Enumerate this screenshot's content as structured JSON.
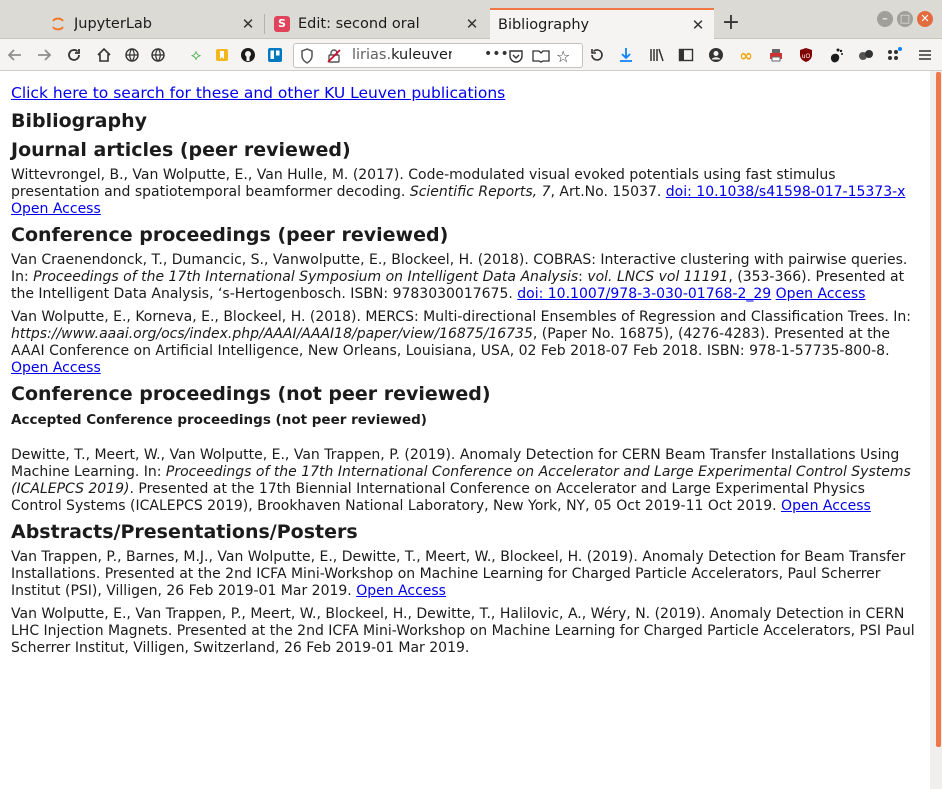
{
  "browser": {
    "tabs": [
      {
        "title": "JupyterLab",
        "favicon_color": "#f37626"
      },
      {
        "title": "Edit: second oral",
        "favicon_color": "#e0445c"
      },
      {
        "title": "Bibliography",
        "favicon_color": ""
      }
    ],
    "url_prefix": "lirias.",
    "url_domain": "kuleuven.",
    "url_more": "•••"
  },
  "page": {
    "search_link": "Click here to search for these and other KU Leuven publications",
    "title": "Bibliography",
    "sections": {
      "journal": {
        "heading": "Journal articles (peer reviewed)",
        "entries": [
          {
            "text_a": "Wittevrongel, B., Van Wolputte, E., Van Hulle, M. (2017). Code-modulated visual evoked potentials using fast stimulus presentation and spatiotemporal beamformer decoding. ",
            "italic_a": "Scientific Reports, 7",
            "text_b": ", Art.No. 15037. ",
            "doi": "doi: 10.1038/s41598-017-15373-x",
            "open_access": "Open Access"
          }
        ]
      },
      "conf_peer": {
        "heading": "Conference proceedings (peer reviewed)",
        "entries": [
          {
            "text_a": "Van Craenendonck, T., Dumancic, S., Vanwolputte, E., Blockeel, H. (2018). COBRAS: Interactive clustering with pairwise queries. In: ",
            "italic_a": "Proceedings of the 17th International Symposium on Intelligent Data Analysis",
            "text_b": ": ",
            "italic_b": "vol. LNCS vol 11191",
            "text_c": ", (353-366). Presented at the Intelligent Data Analysis, ‘s-Hertogenbosch. ISBN: 9783030017675. ",
            "doi": "doi: 10.1007/978-3-030-01768-2_29",
            "open_access": "Open Access"
          },
          {
            "text_a": "Van Wolputte, E., Korneva, E., Blockeel, H. (2018). MERCS: Multi-directional Ensembles of Regression and Classification Trees. In: ",
            "italic_a": "https://www.aaai.org/ocs/index.php/AAAI/AAAI18/paper/view/16875/16735",
            "text_b": ", (Paper No. 16875), (4276-4283). Presented at the AAAI Conference on Artificial Intelligence, New Orleans, Louisiana, USA, 02 Feb 2018-07 Feb 2018. ISBN: 978-1-57735-800-8. ",
            "open_access": "Open Access"
          }
        ]
      },
      "conf_not_peer": {
        "heading": "Conference proceedings (not peer reviewed)",
        "subheading": "Accepted Conference proceedings (not peer reviewed)",
        "entries": [
          {
            "text_a": "Dewitte, T., Meert, W., Van Wolputte, E., Van Trappen, P. (2019). Anomaly Detection for CERN Beam Transfer Installations Using Machine Learning. In: ",
            "italic_a": "Proceedings of the 17th International Conference on Accelerator and Large Experimental Control Systems (ICALEPCS 2019)",
            "text_b": ". Presented at the 17th Biennial International Conference on Accelerator and Large Experimental Physics Control Systems (ICALEPCS 2019), Brookhaven National Laboratory, New York, NY, 05 Oct 2019-11 Oct 2019. ",
            "open_access": "Open Access"
          }
        ]
      },
      "abstracts": {
        "heading": "Abstracts/Presentations/Posters",
        "entries": [
          {
            "text_a": "Van Trappen, P., Barnes, M.J., Van Wolputte, E., Dewitte, T., Meert, W., Blockeel, H. (2019). Anomaly Detection for Beam Transfer Installations. Presented at the 2nd ICFA Mini-Workshop on Machine Learning for Charged Particle Accelerators, Paul Scherrer Institut (PSI), Villigen, 26 Feb 2019-01 Mar 2019. ",
            "open_access": "Open Access"
          },
          {
            "text_a": "Van Wolputte, E., Van Trappen, P., Meert, W., Blockeel, H., Dewitte, T., Halilovic, A., Wéry, N. (2019). Anomaly Detection in CERN LHC Injection Magnets. Presented at the 2nd ICFA Mini-Workshop on Machine Learning for Charged Particle Accelerators, PSI Paul Scherrer Institut, Villigen, Switzerland, 26 Feb 2019-01 Mar 2019."
          }
        ]
      }
    }
  },
  "colors": {
    "accent": "#f07746",
    "link": "#0000ee",
    "tab_bar": "#dcdad5",
    "toolbar": "#f5f4f2"
  }
}
